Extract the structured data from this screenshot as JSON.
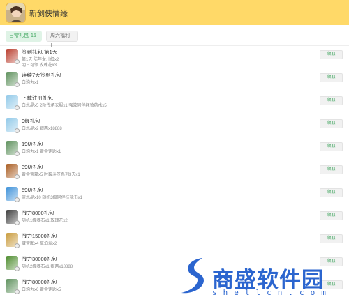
{
  "header": {
    "title": "新剑侠情缘"
  },
  "tabs": [
    {
      "label": "日常礼包",
      "count": "15"
    },
    {
      "label": "周六福利日"
    }
  ],
  "claim_label": "领取",
  "gifts": [
    {
      "title": "签到礼包 第1天",
      "desc": "第1天 防年女儿红x2\n明日可领 玫瑰花x3",
      "icon": "red-pot-icon",
      "color": "#b83a2a"
    },
    {
      "title": "连续7天签到礼包",
      "desc": "白驹丸x1",
      "icon": "jade-pill-icon",
      "color": "#5b8f5a"
    },
    {
      "title": "下载注册礼包",
      "desc": "白水晶x5 2阶传承衣服x1 强效同伴经验药水x5",
      "icon": "white-crystal-icon",
      "color": "#8fc8e8"
    },
    {
      "title": "9级礼包",
      "desc": "白水晶x2 银两x18888",
      "icon": "white-crystal-icon",
      "color": "#8fc8e8"
    },
    {
      "title": "19级礼包",
      "desc": "白驹丸x1 黄金钥匙x1",
      "icon": "jade-pill-icon",
      "color": "#5b8f5a"
    },
    {
      "title": "39级礼包",
      "desc": "黄金宝箱x5 时装斗笠系列3天x1",
      "icon": "treasure-chest-icon",
      "color": "#a85a1e"
    },
    {
      "title": "59级礼包",
      "desc": "蓝水晶x10 随机3级同伴技能书x1",
      "icon": "blue-crystal-icon",
      "color": "#3a8fd8"
    },
    {
      "title": "战力8000礼包",
      "desc": "随机1级魂石x1 玫瑰花x2",
      "icon": "soul-stone-icon",
      "color": "#3a3a3a"
    },
    {
      "title": "战力15000礼包",
      "desc": "藏宝图x4 草泊翠x2",
      "icon": "treasure-map-icon",
      "color": "#c89a3a"
    },
    {
      "title": "战力30000礼包",
      "desc": "随机2级魂石x1 银两x18888",
      "icon": "soul-stone-icon",
      "color": "#4a8a2a"
    },
    {
      "title": "战力80000礼包",
      "desc": "白驹丸x6 黄金钥匙x5",
      "icon": "jade-pill-icon",
      "color": "#5b8f5a"
    }
  ],
  "watermark": {
    "text": "商盛软件园",
    "sub": "shellcn.com",
    "color": "#2b65cf"
  }
}
